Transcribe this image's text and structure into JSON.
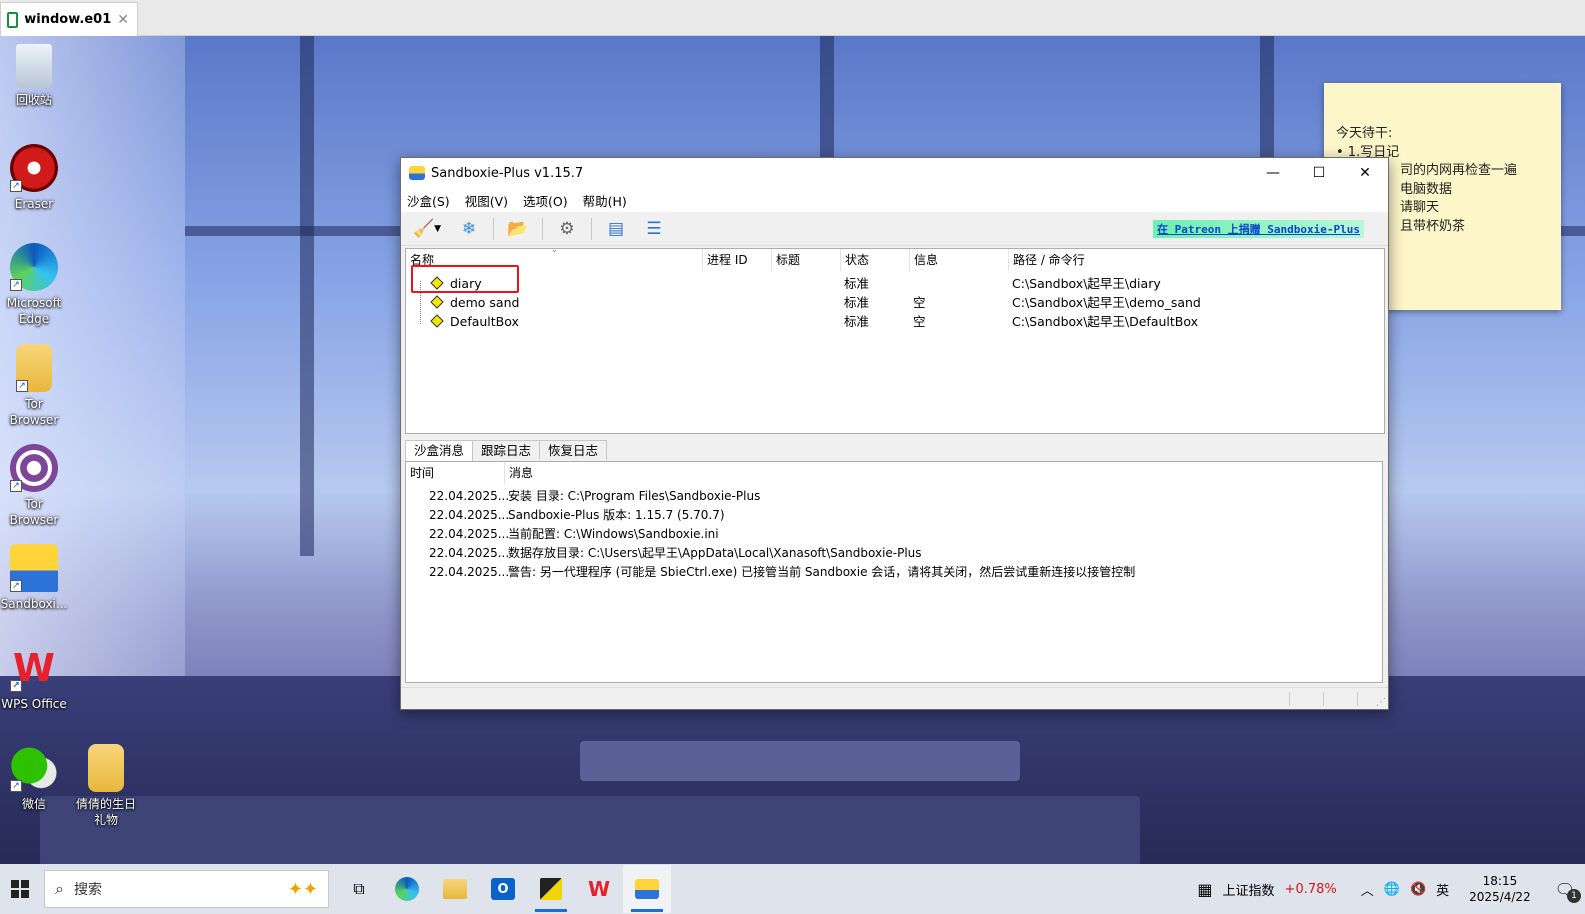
{
  "host_tab": {
    "title": "window.e01",
    "close": "✕"
  },
  "desktop_icons": [
    {
      "label": "回收站"
    },
    {
      "label": "Eraser"
    },
    {
      "label": "Microsoft Edge"
    },
    {
      "label": "Tor Browser"
    },
    {
      "label": "Tor Browser"
    },
    {
      "label": "Sandboxi..."
    },
    {
      "label": "WPS Office"
    },
    {
      "label": "微信"
    },
    {
      "label": "倩倩的生日礼物"
    }
  ],
  "sticky_note": {
    "lines": [
      "今天待干:",
      "• 1.写日记",
      "司的内网再检查一遍",
      "电脑数据",
      "请聊天",
      "且带杯奶茶"
    ]
  },
  "window": {
    "title": "Sandboxie-Plus v1.15.7",
    "controls": {
      "minimize": "—",
      "maximize": "☐",
      "close": "✕"
    },
    "menu": [
      "沙盒(S)",
      "视图(V)",
      "选项(O)",
      "帮助(H)"
    ],
    "patreon_link": "在 Patreon 上捐赠 Sandboxie-Plus",
    "columns": [
      "名称",
      "进程 ID",
      "标题",
      "状态",
      "信息",
      "路径 / 命令行"
    ],
    "boxes": [
      {
        "name": "diary",
        "status": "标准",
        "info": "",
        "path": "C:\\Sandbox\\起早王\\diary"
      },
      {
        "name": "demo sand",
        "status": "标准",
        "info": "空",
        "path": "C:\\Sandbox\\起早王\\demo_sand"
      },
      {
        "name": "DefaultBox",
        "status": "标准",
        "info": "空",
        "path": "C:\\Sandbox\\起早王\\DefaultBox"
      }
    ],
    "tabs": [
      "沙盒消息",
      "跟踪日志",
      "恢复日志"
    ],
    "log_columns": [
      "时间",
      "消息"
    ],
    "log": [
      {
        "time": "22.04.2025...",
        "msg": "安装 目录: C:\\Program Files\\Sandboxie-Plus"
      },
      {
        "time": "22.04.2025...",
        "msg": "Sandboxie-Plus 版本: 1.15.7 (5.70.7)"
      },
      {
        "time": "22.04.2025...",
        "msg": "当前配置: C:\\Windows\\Sandboxie.ini"
      },
      {
        "time": "22.04.2025...",
        "msg": "数据存放目录: C:\\Users\\起早王\\AppData\\Local\\Xanasoft\\Sandboxie-Plus"
      },
      {
        "time": "22.04.2025...",
        "msg": "警告: 另一代理程序 (可能是 SbieCtrl.exe) 已接管当前 Sandboxie 会话，请将其关闭，然后尝试重新连接以接管控制"
      }
    ]
  },
  "taskbar": {
    "search_placeholder": "搜索",
    "stock_name": "上证指数",
    "stock_change": "+0.78%",
    "ime": "英",
    "time": "18:15",
    "date": "2025/4/22",
    "notification_count": "1"
  },
  "colors": {
    "highlight_box": "#e8141f",
    "stock_up": "#d4141e",
    "accent": "#1a6ed8"
  }
}
